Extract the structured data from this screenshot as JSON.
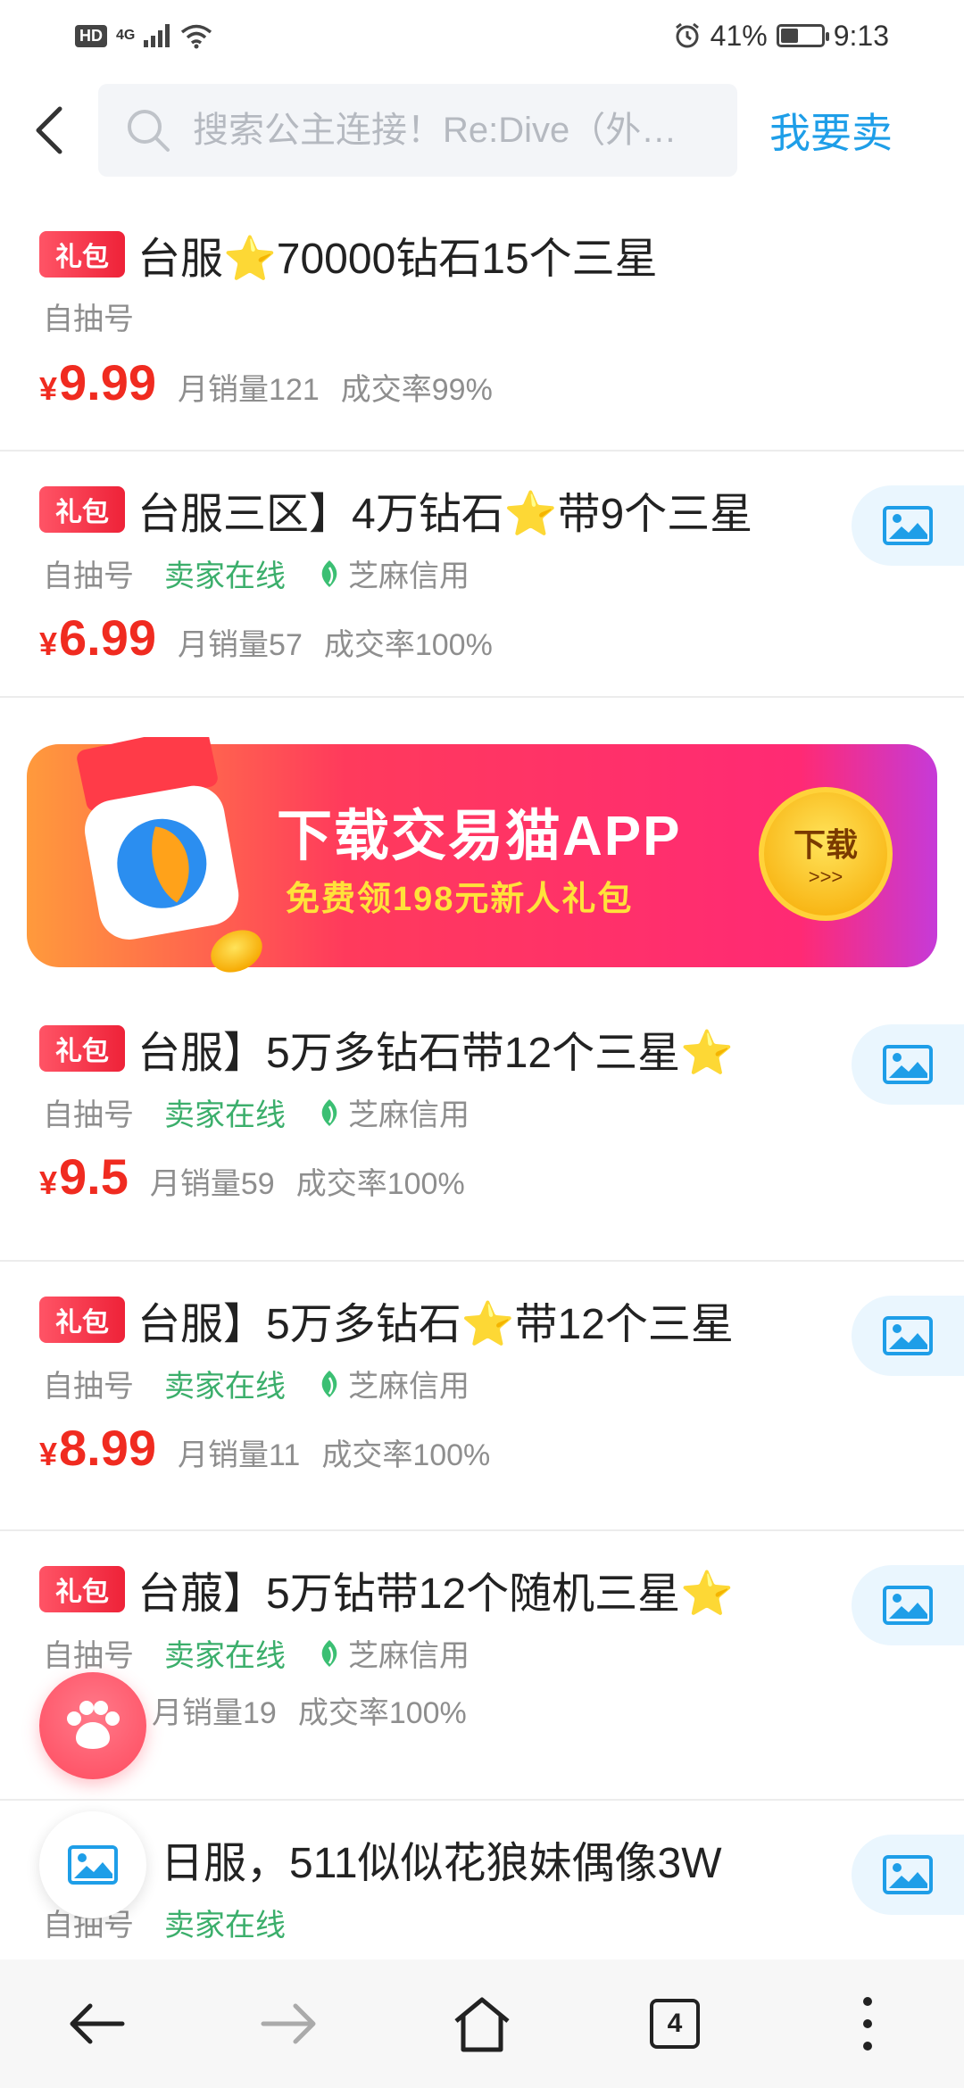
{
  "status_bar": {
    "hd": "HD",
    "network": "4G",
    "battery_percent": "41%",
    "battery_level": 0.41,
    "time": "9:13"
  },
  "header": {
    "search_placeholder": "搜索公主连接！Re:Dive（外…",
    "sell_label": "我要卖"
  },
  "banner": {
    "title": "下载交易猫APP",
    "subtitle": "免费领198元新人礼包",
    "button_label": "下载",
    "button_arrows": ">>>"
  },
  "listings": [
    {
      "badge": "礼包",
      "title_parts": [
        "台服",
        "⭐",
        "70000钻石15个三星"
      ],
      "tag_type": "自抽号",
      "seller_online": "",
      "credit": "",
      "price": "9.99",
      "monthly_sales": "月销量121",
      "deal_rate": "成交率99%"
    },
    {
      "badge": "礼包",
      "title_parts": [
        "台服三区】4万钻石",
        "⭐",
        "带9个三星"
      ],
      "tag_type": "自抽号",
      "seller_online": "卖家在线",
      "credit": "芝麻信用",
      "price": "6.99",
      "monthly_sales": "月销量57",
      "deal_rate": "成交率100%"
    },
    {
      "badge": "礼包",
      "title_parts": [
        "台服】5万多钻石带12个三星",
        "⭐",
        ""
      ],
      "tag_type": "自抽号",
      "seller_online": "卖家在线",
      "credit": "芝麻信用",
      "price": "9.5",
      "monthly_sales": "月销量59",
      "deal_rate": "成交率100%"
    },
    {
      "badge": "礼包",
      "title_parts": [
        "台服】5万多钻石",
        "⭐",
        "带12个三星"
      ],
      "tag_type": "自抽号",
      "seller_online": "卖家在线",
      "credit": "芝麻信用",
      "price": "8.99",
      "monthly_sales": "月销量11",
      "deal_rate": "成交率100%"
    },
    {
      "badge": "礼包",
      "title_parts": [
        "台菔】5万钻带12个随机三星",
        "⭐",
        ""
      ],
      "tag_type": "自抽号",
      "seller_online": "卖家在线",
      "credit": "芝麻信用",
      "price": "",
      "monthly_sales": "月销量19",
      "deal_rate": "成交率100%"
    },
    {
      "badge": "",
      "title_parts": [
        "日服，511似似花狼妹偶像3W",
        "",
        ""
      ],
      "tag_type": "自抽号",
      "seller_online": "卖家在线",
      "credit": "",
      "price": "",
      "monthly_sales": "",
      "deal_rate": ""
    }
  ],
  "bottom_nav": {
    "tab_count": "4"
  },
  "colors": {
    "accent_blue": "#1e9ee8",
    "price_red": "#f02b20",
    "online_green": "#3bae6b",
    "badge_red": "#ee2238"
  }
}
